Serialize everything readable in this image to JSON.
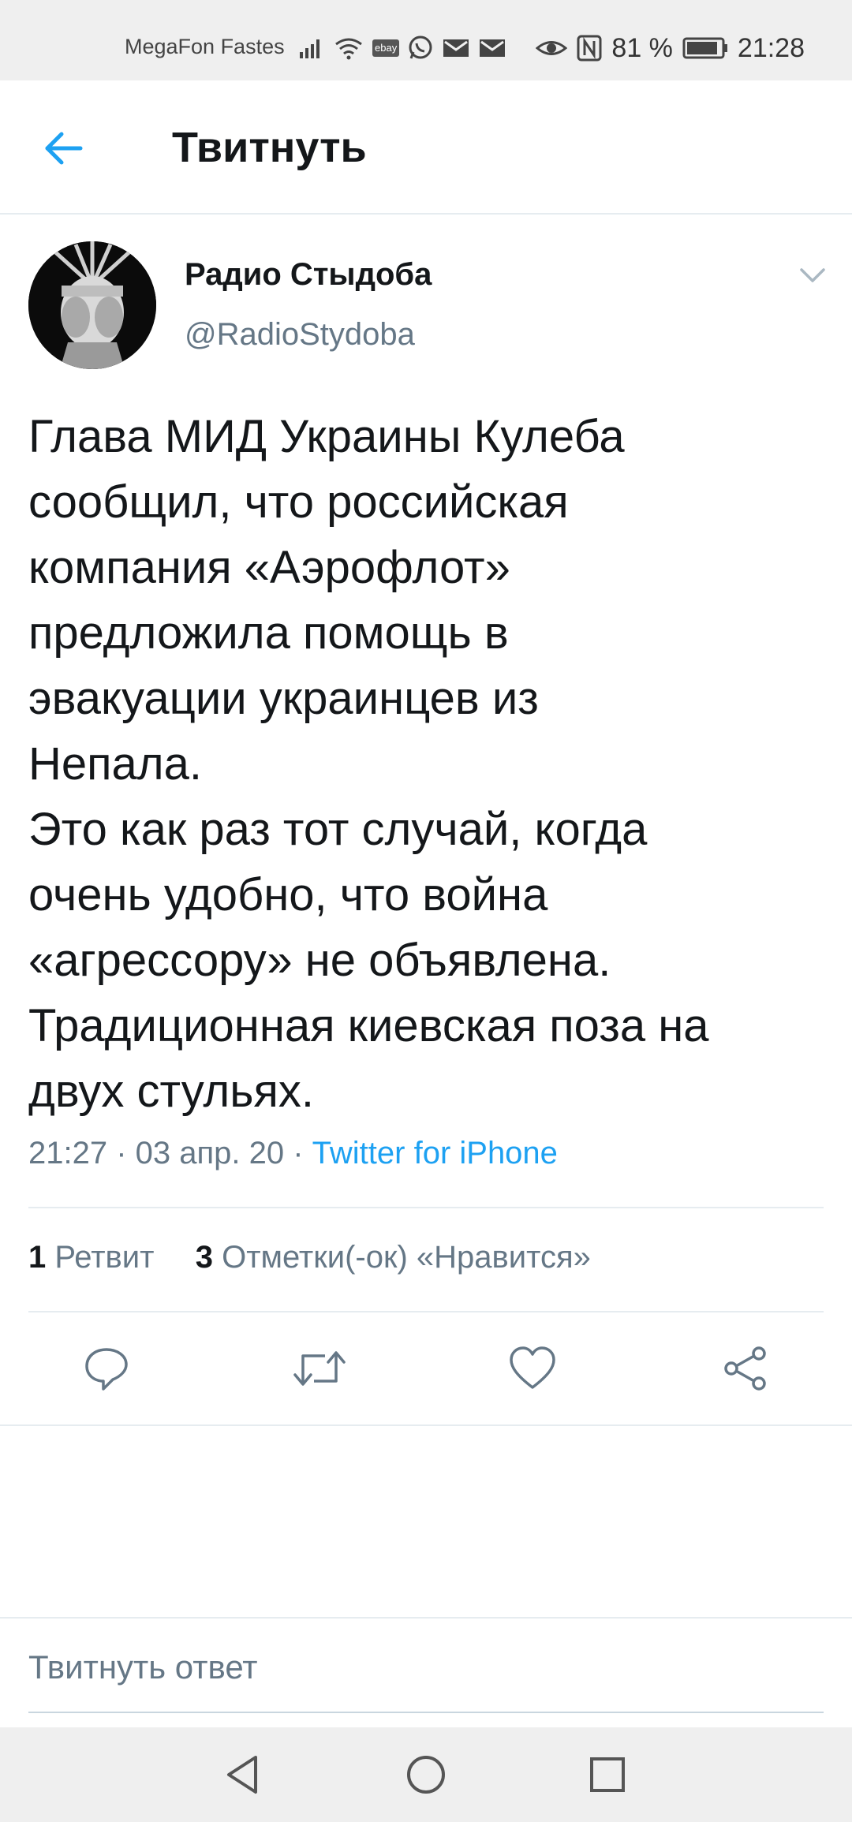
{
  "status_bar": {
    "carrier": "MegaFon Fastes",
    "ebay_label": "ebay",
    "battery_percent": "81 %",
    "time": "21:28",
    "icons": [
      "signal-icon",
      "wifi-icon",
      "ebay-icon",
      "whatsapp-icon",
      "mail-icon",
      "mail-icon",
      "eye-icon",
      "nfc-icon",
      "battery-icon"
    ]
  },
  "app_bar": {
    "title": "Твитнуть",
    "back_icon": "arrow-left-icon"
  },
  "tweet": {
    "author_name": "Радио Стыдоба",
    "author_handle": "@RadioStydoba",
    "text": "Глава МИД Украины Кулеба\nсообщил, что российская\nкомпания «Аэрофлот»\nпредложила помощь в\nэвакуации украинцев из\nНепала.\nЭто как раз тот случай, когда\nочень удобно, что война\n«агрессору» не объявлена.\nТрадиционная киевская поза на\nдвух стульях.",
    "timestamp": "21:27 · 03 апр. 20 · ",
    "source": "Twitter for iPhone"
  },
  "stats": {
    "retweets_count": "1",
    "retweets_label": "Ретвит",
    "likes_count": "3",
    "likes_label": "Отметки(-ок) «Нравится»"
  },
  "actions": [
    "reply-icon",
    "retweet-icon",
    "like-icon",
    "share-icon"
  ],
  "reply_box": {
    "placeholder": "Твитнуть ответ"
  },
  "colors": {
    "accent": "#1da1f2",
    "text": "#14171a",
    "secondary": "#657786",
    "divider": "#e6ecf0"
  }
}
